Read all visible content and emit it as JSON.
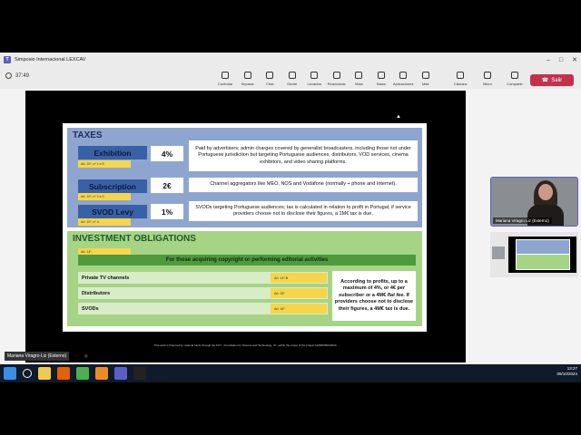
{
  "window": {
    "title": "Simposio Internacional LEXCAV",
    "app_icon_label": "T"
  },
  "meeting": {
    "elapsed": "37:49"
  },
  "toolbar": {
    "items": [
      {
        "label": "Controlar",
        "icon": "control-icon"
      },
      {
        "label": "Separar",
        "icon": "pop-out-icon"
      },
      {
        "label": "Chat",
        "icon": "chat-icon"
      },
      {
        "label": "Gente",
        "icon": "people-icon"
      },
      {
        "label": "Levantar",
        "icon": "raise-hand-icon"
      },
      {
        "label": "Reaccionar",
        "icon": "react-icon"
      },
      {
        "label": "Vista",
        "icon": "view-icon"
      },
      {
        "label": "Salas",
        "icon": "rooms-icon"
      },
      {
        "label": "Aplicaciones",
        "icon": "apps-icon"
      },
      {
        "label": "Más",
        "icon": "more-icon"
      }
    ],
    "devices": [
      {
        "label": "Cámara",
        "icon": "camera-icon"
      },
      {
        "label": "Micro",
        "icon": "mic-icon"
      },
      {
        "label": "Compartir",
        "icon": "share-icon"
      }
    ],
    "leave_label": "Salir"
  },
  "slide": {
    "taxes_title": "TAXES",
    "taxes": [
      {
        "name": "Exhibition",
        "rate": "4%",
        "article": "Art. 10º, nº 1 e 5",
        "desc": "Paid by advertisers; admin charges covered by generalist broadcasters, including those not under Portuguese jurisdiction but targeting Portuguese audiences, distributors, VOD services, cinema exhibitors, and video sharing platforms."
      },
      {
        "name": "Subscription",
        "rate": "2€",
        "article": "Art. 10º, nº 2 e 3",
        "desc": "Channel aggregators like MEO, NOS and Vodafone (normally + phone and Internet)."
      },
      {
        "name": "SVOD Levy",
        "rate": "1%",
        "article": "Art. 10º, nº 4",
        "desc": "SVODs targeting Portuguese audiences; tax is calculated in relation to profit in Portugal; if service providers choose not to disclose their figures, a 1M€ tax is due."
      }
    ],
    "invest_title": "INVESTMENT OBLIGATIONS",
    "invest_article": "Art. 14º",
    "invest_banner": "For those acquiring copyright or performing editorial activities",
    "invest_rows": [
      {
        "label": "Private TV channels",
        "article": "Art. 14º-B"
      },
      {
        "label": "Distributors",
        "article": "Art. 15º"
      },
      {
        "label": "SVODs",
        "article": "Art. 16º"
      }
    ],
    "invest_note_part1": "According to profits, up to a maximum of 4%, or 4€ per subscriber or a 4M€ ",
    "invest_note_em": "flat fee",
    "invest_note_part2": ". If providers choose not to disclose their figures, a 4M€ tax is due.",
    "footnote": "This work is financed by national funds through the FCT - Foundation for Science and Technology, I.P., within the scope of the project 1408/00500/2020."
  },
  "participants": {
    "speaker_name": "Mariana Viragro Liz (Externo)",
    "bottom_name": "Mariana Viragro Liz (Externo)"
  },
  "taskbar": {
    "icons": [
      "windows-start-icon",
      "search-icon",
      "file-explorer-icon",
      "firefox-icon",
      "chrome-icon",
      "vlc-icon",
      "teams-icon",
      "nox-icon"
    ],
    "time": "13:27",
    "date": "09/10/2024"
  },
  "colors": {
    "taxes_bg": "#8ea6cf",
    "taxes_label": "#3a60a6",
    "invest_bg": "#a6d485",
    "invest_banner": "#4f9a3c",
    "article_tag": "#f7d54a",
    "leave_button": "#c4314b",
    "accent": "#5b5fc7"
  }
}
